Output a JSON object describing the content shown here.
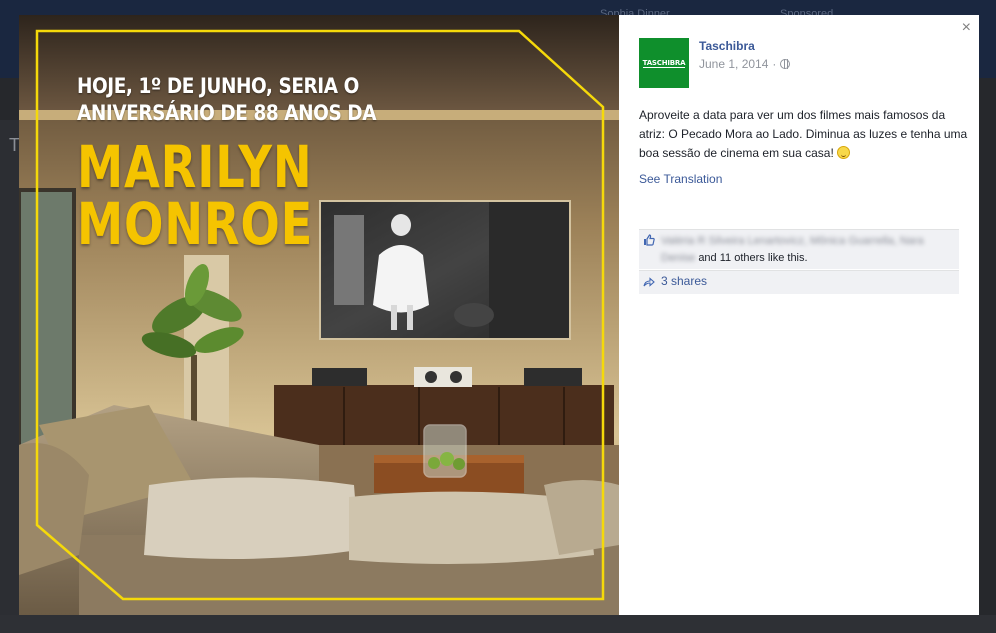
{
  "background": {
    "hint_left": "Sophia Dinner",
    "hint_right": "Sponsored",
    "side_letter": "T"
  },
  "photo": {
    "headline_line1": "HOJE, 1º DE JUNHO, SERIA O",
    "headline_line2": "ANIVERSÁRIO DE 88 ANOS DA",
    "name_line1": "MARILYN",
    "name_line2": "MONROE",
    "accent_color": "#f5c400"
  },
  "post": {
    "page_name": "Taschibra",
    "avatar_text": "TASCHIBRA",
    "date": "June 1, 2014",
    "separator": "·",
    "privacy_icon": "globe-icon",
    "text": "Aproveite a data para ver um dos filmes mais famosos da atriz: O Pecado Mora ao Lado. Diminua as luzes e tenha uma boa sessão de cinema em sua casa!",
    "emoji": "smile-icon",
    "see_translation": "See Translation",
    "close_label": "×"
  },
  "engagement": {
    "liked_by_blurred": "Valéria R Silveira Lenartovicz, Mônica Guarrella, Nara Denise",
    "likes_suffix": "and 11 others like this.",
    "shares": "3 shares"
  }
}
